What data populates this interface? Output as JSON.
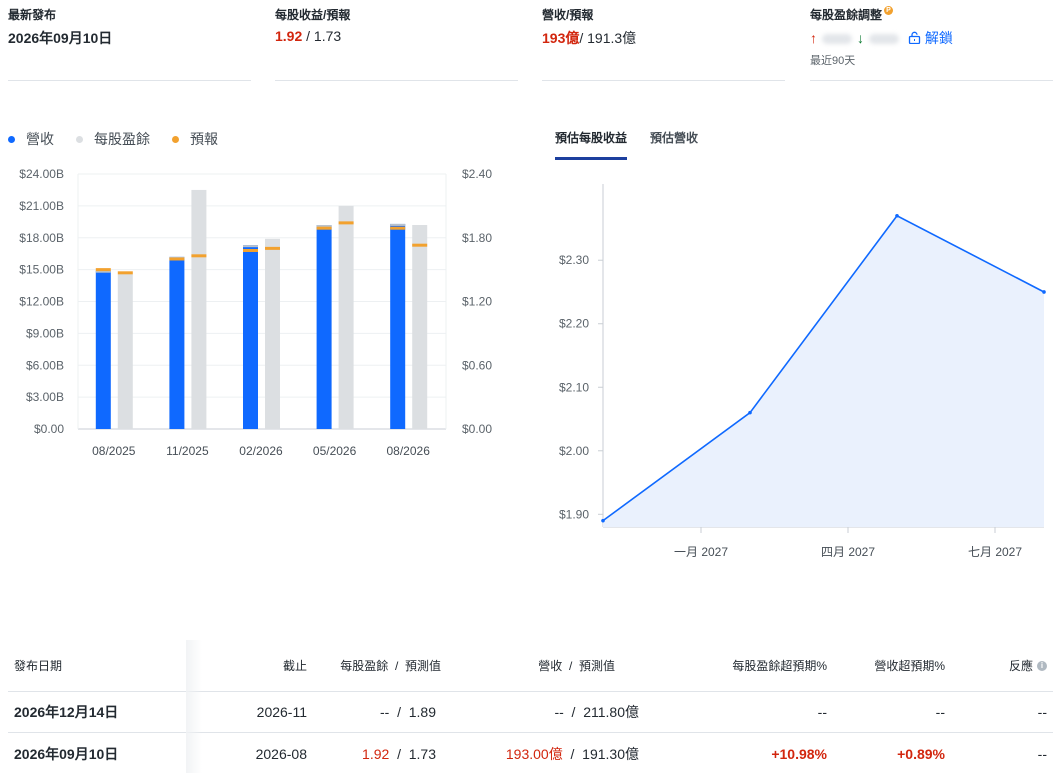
{
  "kpis": {
    "latest_release": {
      "label": "最新發布",
      "value": "2026年09月10日"
    },
    "eps": {
      "label": "每股收益/預報",
      "actual": "1.92",
      "sep": " / ",
      "forecast": "1.73"
    },
    "revenue": {
      "label": "營收/預報",
      "actual": "193億",
      "sep": "/ ",
      "forecast": "191.3億"
    },
    "eps_revision": {
      "label": "每股盈餘調整",
      "badge": "P",
      "up_arrow": "↑",
      "down_arrow": "↓",
      "unlock": "解鎖",
      "period": "最近90天"
    }
  },
  "legend": [
    {
      "label": "營收",
      "color": "#0f69ff"
    },
    {
      "label": "每股盈餘",
      "color": "#dcdfe2"
    },
    {
      "label": "預報",
      "color": "#f2a12e"
    }
  ],
  "tabs": [
    {
      "label": "預估每股收益",
      "active": true
    },
    {
      "label": "預估營收",
      "active": false
    }
  ],
  "chart_data": [
    {
      "type": "bar",
      "categories": [
        "08/2025",
        "11/2025",
        "02/2026",
        "05/2026",
        "08/2026"
      ],
      "y_left_ticks": [
        "$0.00",
        "$3.00B",
        "$6.00B",
        "$9.00B",
        "$12.00B",
        "$15.00B",
        "$18.00B",
        "$21.00B",
        "$24.00B"
      ],
      "y_right_ticks": [
        "$0.00",
        "$0.60",
        "$1.20",
        "$1.80",
        "$2.40"
      ],
      "y_left_lim": [
        0,
        24
      ],
      "y_right_lim": [
        0,
        2.4
      ],
      "series": [
        {
          "name": "營收",
          "axis": "left",
          "values": [
            14.9,
            16.2,
            17.3,
            19.2,
            19.3
          ],
          "estimates": [
            15.0,
            16.0,
            16.8,
            18.9,
            18.9
          ]
        },
        {
          "name": "每股盈餘",
          "axis": "right",
          "values": [
            1.46,
            2.25,
            1.79,
            2.1,
            1.92
          ],
          "estimates": [
            1.47,
            1.63,
            1.7,
            1.94,
            1.73
          ]
        }
      ],
      "colors": {
        "revenue": "#0f69ff",
        "eps": "#dcdfe2",
        "estimate": "#f2a12e",
        "revenue_cap": "#b9c2cc"
      }
    },
    {
      "type": "area",
      "x": [
        0,
        3,
        6,
        9
      ],
      "x_ticks": [
        {
          "x": 2,
          "label": "一月 2027"
        },
        {
          "x": 5,
          "label": "四月 2027"
        },
        {
          "x": 8,
          "label": "七月 2027"
        }
      ],
      "values": [
        1.89,
        2.06,
        2.37,
        2.25
      ],
      "y_ticks": [
        "$1.90",
        "$2.00",
        "$2.10",
        "$2.20",
        "$2.30"
      ],
      "y_tick_values": [
        1.9,
        2.0,
        2.1,
        2.2,
        2.3
      ],
      "ylim": [
        1.88,
        2.42
      ],
      "xlim": [
        0,
        9
      ],
      "colors": {
        "line": "#0f69ff",
        "fill": "#eaf1fd"
      }
    }
  ],
  "table": {
    "headers": {
      "date": "發布日期",
      "period": "截止",
      "eps": "每股盈餘",
      "sep": "/",
      "eps_forecast": "預測值",
      "revenue": "營收",
      "revenue_forecast": "預測值",
      "eps_surprise": "每股盈餘超預期%",
      "revenue_surprise": "營收超預期%",
      "reaction": "反應"
    },
    "rows": [
      {
        "date": "2026年12月14日",
        "period": "2026-11",
        "eps": "--",
        "eps_sep": "/",
        "eps_forecast": "1.89",
        "revenue": "--",
        "rev_sep": "/",
        "revenue_forecast": "211.80億",
        "eps_surprise": "--",
        "revenue_surprise": "--",
        "reaction": "--"
      },
      {
        "date": "2026年09月10日",
        "period": "2026-08",
        "eps": "1.92",
        "eps_sep": "/",
        "eps_forecast": "1.73",
        "revenue": "193.00億",
        "rev_sep": "/",
        "revenue_forecast": "191.30億",
        "eps_surprise": "+10.98%",
        "revenue_surprise": "+0.89%",
        "reaction": "--"
      }
    ]
  }
}
